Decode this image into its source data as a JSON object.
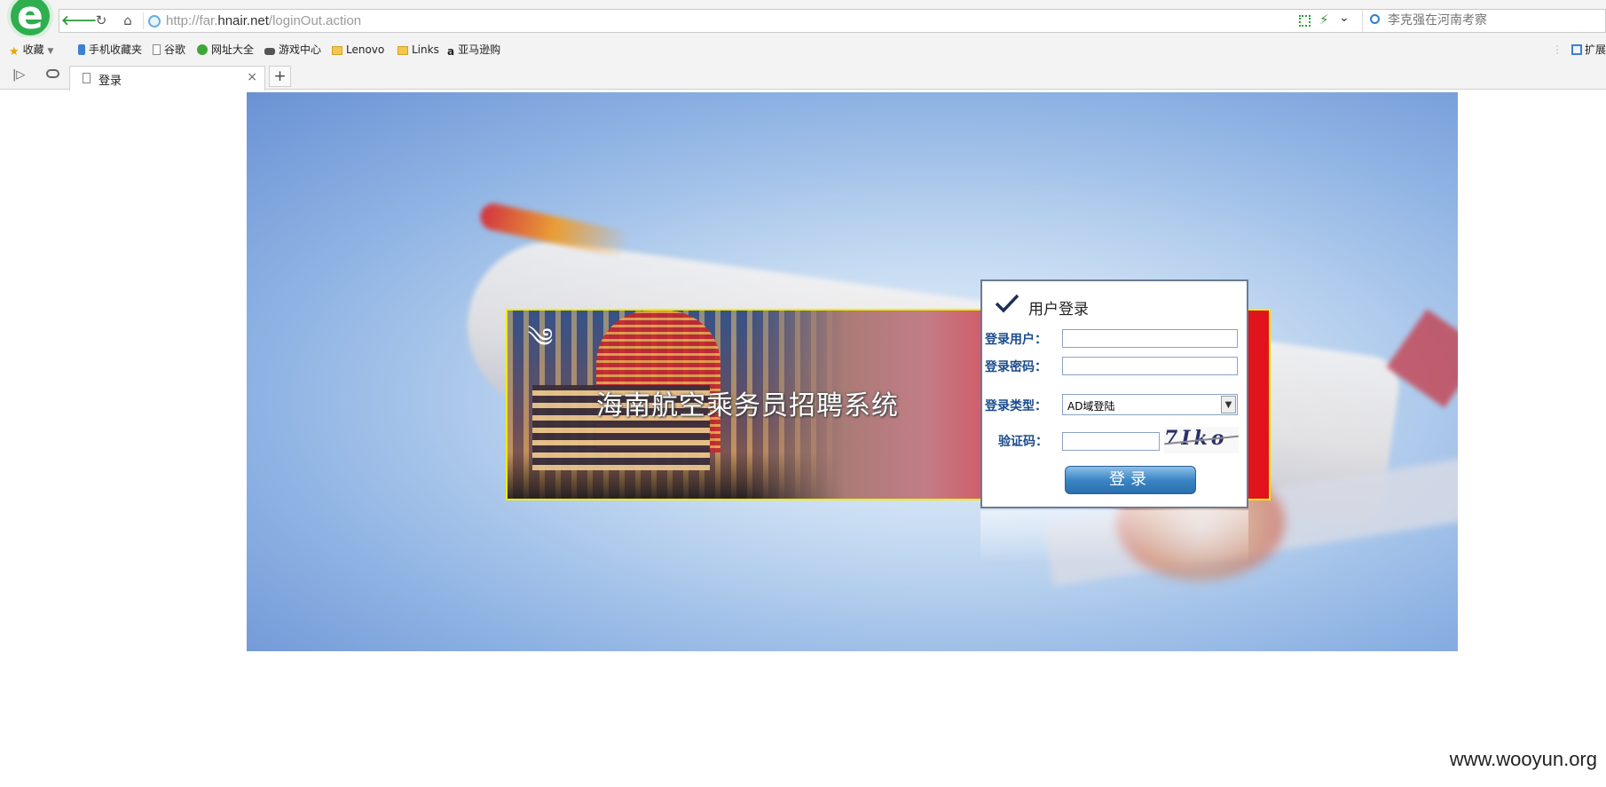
{
  "browser": {
    "back_glyph": "🡐",
    "reload_glyph": "↻",
    "home_glyph": "⌂",
    "url_prefix": "http://far.",
    "url_domain": "hnair.net",
    "url_path": "/loginOut.action",
    "search_placeholder": "李克强在河南考察",
    "bookmarks": [
      {
        "label": "收藏",
        "icon": "star-icon"
      },
      {
        "label": "手机收藏夹",
        "icon": "phone-icon"
      },
      {
        "label": "谷歌",
        "icon": "page-icon"
      },
      {
        "label": "网址大全",
        "icon": "globe-icon"
      },
      {
        "label": "游戏中心",
        "icon": "gamepad-icon"
      },
      {
        "label": "Lenovo",
        "icon": "folder-icon"
      },
      {
        "label": "Links",
        "icon": "folder-icon"
      },
      {
        "label": "亚马逊购",
        "icon": "amazon-icon"
      }
    ],
    "extensions_label": "扩展",
    "tab_title": "登录",
    "tab_close_glyph": "×",
    "new_tab_glyph": "+"
  },
  "page": {
    "banner_title": "海南航空乘务员招聘系统",
    "login": {
      "title": "用户登录",
      "username_label": "登录用户：",
      "username_value": "",
      "password_label": "登录密码：",
      "password_value": "",
      "type_label": "登录类型：",
      "type_value": "AD域登陆",
      "captcha_label": "验证码：",
      "captcha_value": "",
      "captcha_text": "7Iko",
      "submit_label": "登录"
    },
    "colors": {
      "banner_border": "#f0ec00",
      "banner_red": "#e3121b",
      "label_blue": "#1b4c8c",
      "button_blue": "#3b86c5"
    }
  },
  "watermark": "www.wooyun.org"
}
